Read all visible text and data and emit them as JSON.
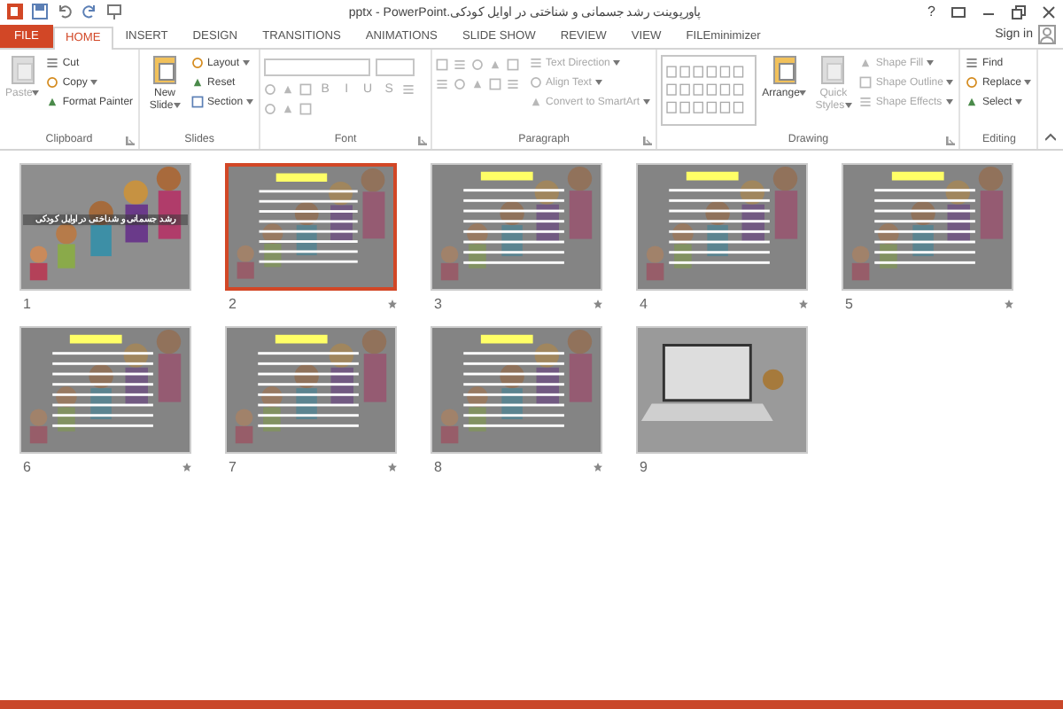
{
  "window": {
    "title": "پاورپوینت رشد جسمانی و شناختی در اوایل کودکی.pptx - PowerPoint",
    "help": "?",
    "sign_in": "Sign in"
  },
  "tabs": [
    {
      "label": "FILE",
      "kind": "file",
      "selected": false
    },
    {
      "label": "HOME",
      "kind": "tab",
      "selected": true
    },
    {
      "label": "INSERT",
      "kind": "tab",
      "selected": false
    },
    {
      "label": "DESIGN",
      "kind": "tab",
      "selected": false
    },
    {
      "label": "TRANSITIONS",
      "kind": "tab",
      "selected": false
    },
    {
      "label": "ANIMATIONS",
      "kind": "tab",
      "selected": false
    },
    {
      "label": "SLIDE SHOW",
      "kind": "tab",
      "selected": false
    },
    {
      "label": "REVIEW",
      "kind": "tab",
      "selected": false
    },
    {
      "label": "VIEW",
      "kind": "tab",
      "selected": false
    },
    {
      "label": "FILEminimizer",
      "kind": "tab",
      "selected": false
    }
  ],
  "ribbon": {
    "groups": [
      {
        "label": "Clipboard",
        "launcher": true,
        "items": [
          {
            "kind": "large",
            "label": "Paste",
            "dropdown": true,
            "disabled": true
          },
          {
            "kind": "small",
            "label": "Cut",
            "dropdown": false,
            "disabled": false
          },
          {
            "kind": "small",
            "label": "Copy",
            "dropdown": true,
            "disabled": false
          },
          {
            "kind": "small",
            "label": "Format Painter",
            "dropdown": false,
            "disabled": false
          }
        ]
      },
      {
        "label": "Slides",
        "launcher": false,
        "items": [
          {
            "kind": "large",
            "label": "New Slide",
            "dropdown": true,
            "disabled": false
          },
          {
            "kind": "small",
            "label": "Layout",
            "dropdown": true,
            "disabled": false
          },
          {
            "kind": "small",
            "label": "Reset",
            "dropdown": false,
            "disabled": false
          },
          {
            "kind": "small",
            "label": "Section",
            "dropdown": true,
            "disabled": false
          }
        ]
      },
      {
        "label": "Font",
        "launcher": true,
        "items": [
          {
            "kind": "field",
            "disabled": true
          },
          {
            "kind": "field",
            "disabled": true
          },
          {
            "kind": "icon",
            "disabled": true
          },
          {
            "kind": "icon",
            "disabled": true
          },
          {
            "kind": "icon",
            "disabled": true
          },
          {
            "kind": "toggle",
            "label": "B",
            "disabled": true
          },
          {
            "kind": "toggle",
            "label": "I",
            "disabled": true
          },
          {
            "kind": "toggle",
            "label": "U",
            "disabled": true
          },
          {
            "kind": "toggle",
            "label": "S",
            "disabled": true
          },
          {
            "kind": "icon",
            "disabled": true
          },
          {
            "kind": "icon",
            "disabled": true
          },
          {
            "kind": "icon",
            "disabled": true
          },
          {
            "kind": "icon",
            "disabled": true
          }
        ]
      },
      {
        "label": "Paragraph",
        "launcher": true,
        "items": [
          {
            "kind": "icon",
            "disabled": true
          },
          {
            "kind": "icon",
            "disabled": true
          },
          {
            "kind": "icon",
            "disabled": true
          },
          {
            "kind": "icon",
            "disabled": true
          },
          {
            "kind": "icon",
            "disabled": true
          },
          {
            "kind": "icon",
            "disabled": true
          },
          {
            "kind": "icon",
            "disabled": true
          },
          {
            "kind": "icon",
            "disabled": true
          },
          {
            "kind": "icon",
            "disabled": true
          },
          {
            "kind": "icon",
            "disabled": true
          },
          {
            "kind": "small",
            "label": "Text Direction",
            "dropdown": true,
            "disabled": true
          },
          {
            "kind": "small",
            "label": "Align Text",
            "dropdown": true,
            "disabled": true
          },
          {
            "kind": "small",
            "label": "Convert to SmartArt",
            "dropdown": true,
            "disabled": true
          }
        ]
      },
      {
        "label": "Drawing",
        "launcher": true,
        "items": [
          {
            "kind": "gallery",
            "disabled": true
          },
          {
            "kind": "large",
            "label": "Arrange",
            "dropdown": true,
            "disabled": false
          },
          {
            "kind": "large",
            "label": "Quick Styles",
            "dropdown": true,
            "disabled": true
          },
          {
            "kind": "small",
            "label": "Shape Fill",
            "dropdown": true,
            "disabled": true
          },
          {
            "kind": "small",
            "label": "Shape Outline",
            "dropdown": true,
            "disabled": true
          },
          {
            "kind": "small",
            "label": "Shape Effects",
            "dropdown": true,
            "disabled": true
          }
        ]
      },
      {
        "label": "Editing",
        "launcher": false,
        "items": [
          {
            "kind": "small",
            "label": "Find",
            "dropdown": false,
            "disabled": false
          },
          {
            "kind": "small",
            "label": "Replace",
            "dropdown": true,
            "disabled": false
          },
          {
            "kind": "small",
            "label": "Select",
            "dropdown": true,
            "disabled": false
          }
        ]
      }
    ]
  },
  "slides": [
    {
      "number": "1",
      "kind": "title",
      "title": "رشد جسمانی و شناختی در اوایل کودکی",
      "selected": false,
      "transition": false
    },
    {
      "number": "2",
      "kind": "content",
      "selected": true,
      "transition": true
    },
    {
      "number": "3",
      "kind": "content",
      "selected": false,
      "transition": true
    },
    {
      "number": "4",
      "kind": "content",
      "selected": false,
      "transition": true
    },
    {
      "number": "5",
      "kind": "content",
      "selected": false,
      "transition": true
    },
    {
      "number": "6",
      "kind": "content",
      "selected": false,
      "transition": true
    },
    {
      "number": "7",
      "kind": "content",
      "selected": false,
      "transition": true
    },
    {
      "number": "8",
      "kind": "content",
      "selected": false,
      "transition": true
    },
    {
      "number": "9",
      "kind": "photo",
      "selected": false,
      "transition": false
    }
  ]
}
